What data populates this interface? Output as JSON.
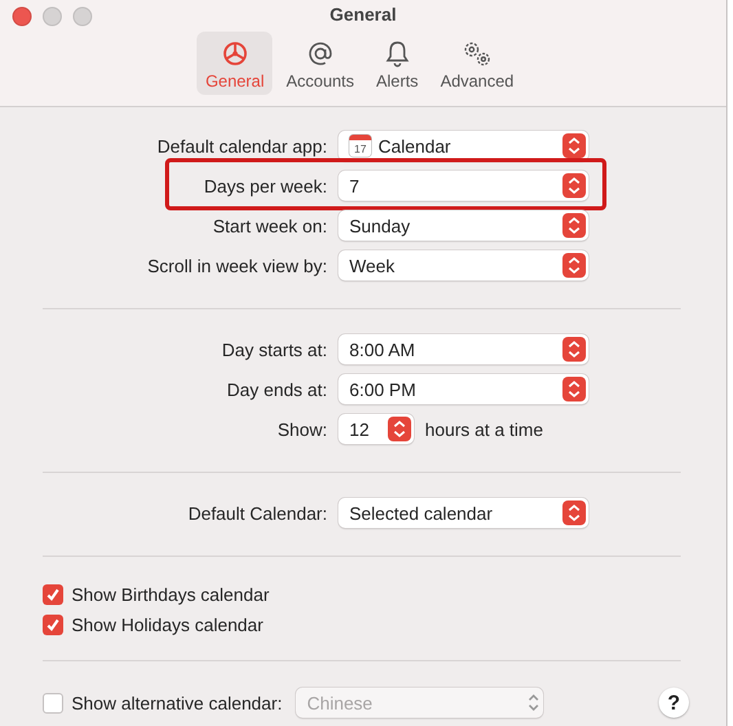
{
  "window": {
    "title": "General"
  },
  "tabs": [
    {
      "label": "General",
      "selected": true
    },
    {
      "label": "Accounts",
      "selected": false
    },
    {
      "label": "Alerts",
      "selected": false
    },
    {
      "label": "Advanced",
      "selected": false
    }
  ],
  "groups": [
    {
      "rows": [
        {
          "kind": "popup",
          "label": "Default calendar app:",
          "value": "Calendar",
          "icon_day": "17",
          "highlighted": false
        },
        {
          "kind": "popup",
          "label": "Days per week:",
          "value": "7",
          "highlighted": true
        },
        {
          "kind": "popup",
          "label": "Start week on:",
          "value": "Sunday",
          "highlighted": false
        },
        {
          "kind": "popup",
          "label": "Scroll in week view by:",
          "value": "Week",
          "highlighted": false
        }
      ]
    },
    {
      "rows": [
        {
          "kind": "popup",
          "label": "Day starts at:",
          "value": "8:00 AM",
          "highlighted": false
        },
        {
          "kind": "popup",
          "label": "Day ends at:",
          "value": "6:00 PM",
          "highlighted": false
        },
        {
          "kind": "short_popup",
          "label": "Show:",
          "value": "12",
          "suffix": "hours at a time",
          "highlighted": false
        }
      ]
    },
    {
      "rows": [
        {
          "kind": "popup",
          "label": "Default Calendar:",
          "value": "Selected calendar",
          "highlighted": false
        }
      ]
    },
    {
      "rows": [
        {
          "kind": "checkbox",
          "label": "Show Birthdays calendar",
          "checked": true
        },
        {
          "kind": "checkbox",
          "label": "Show Holidays calendar",
          "checked": true
        }
      ]
    }
  ],
  "alternative_calendar": {
    "label": "Show alternative calendar:",
    "checked": false,
    "value": "Chinese",
    "disabled": true
  },
  "help_button": "?"
}
